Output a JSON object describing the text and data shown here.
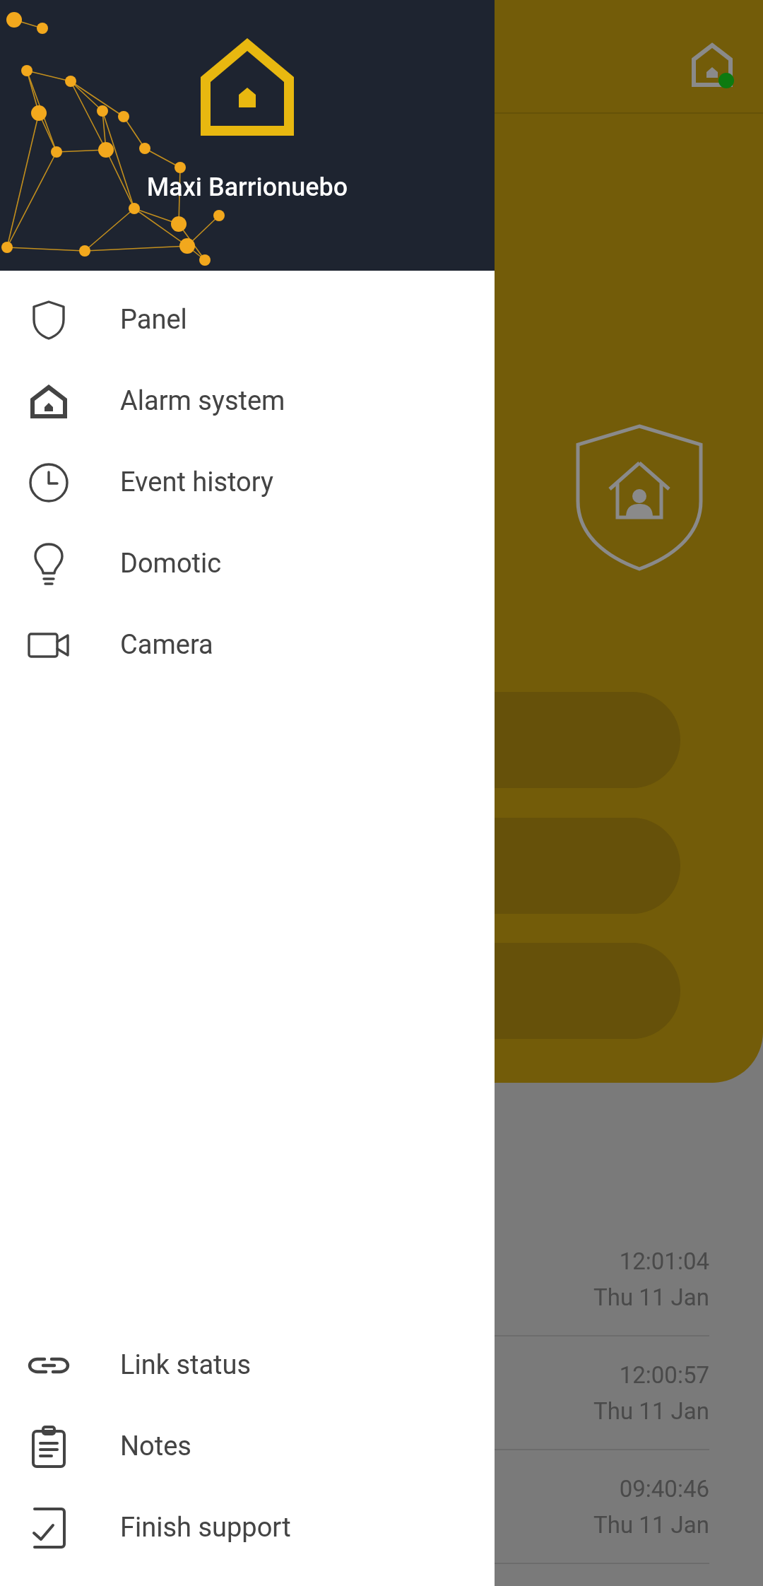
{
  "drawer": {
    "user_name": "Maxi Barrionuebo",
    "menu_items": [
      {
        "label": "Panel"
      },
      {
        "label": "Alarm system"
      },
      {
        "label": "Event history"
      },
      {
        "label": "Domotic"
      },
      {
        "label": "Camera"
      }
    ],
    "bottom_items": [
      {
        "label": "Link status"
      },
      {
        "label": "Notes"
      },
      {
        "label": "Finish support"
      }
    ]
  },
  "background": {
    "connected": true,
    "events": [
      {
        "time": "12:01:04",
        "date": "Thu 11 Jan"
      },
      {
        "time": "12:00:57",
        "date": "Thu 11 Jan"
      },
      {
        "time": "09:40:46",
        "date": "Thu 11 Jan"
      }
    ]
  }
}
